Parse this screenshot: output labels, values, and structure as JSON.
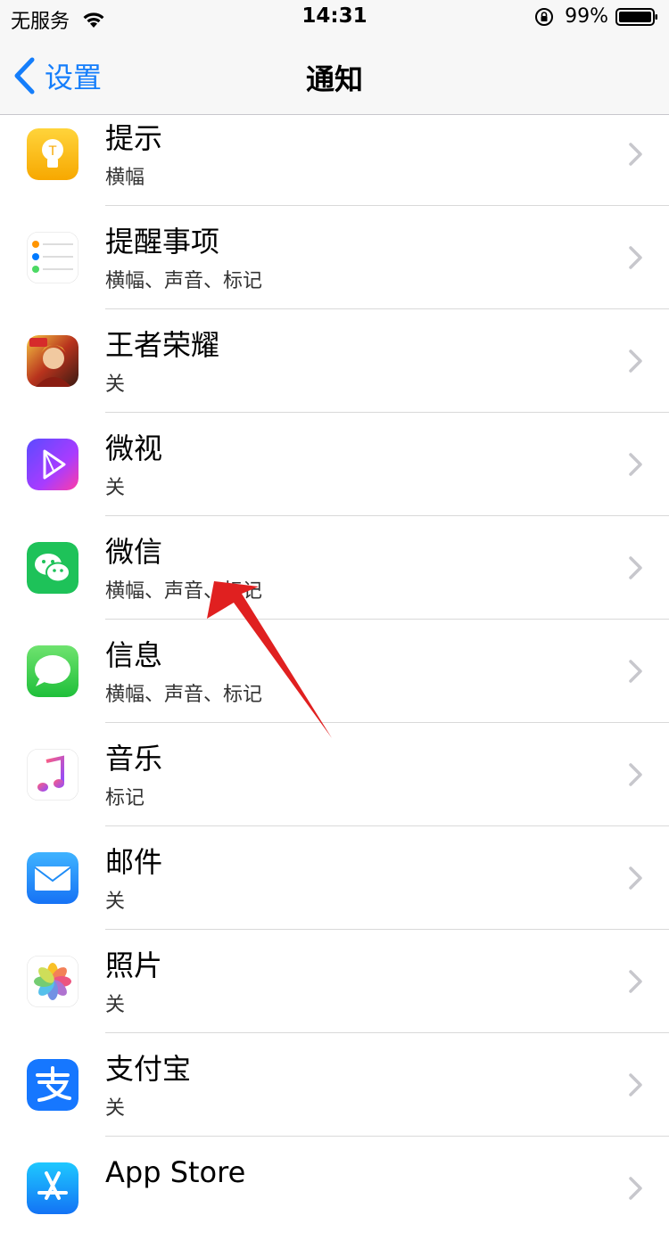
{
  "status": {
    "carrier": "无服务",
    "time": "14:31",
    "battery": "99%"
  },
  "nav": {
    "back_label": "设置",
    "title": "通知"
  },
  "apps": [
    {
      "title": "提示",
      "subtitle": "横幅",
      "icon": "tips-icon"
    },
    {
      "title": "提醒事项",
      "subtitle": "横幅、声音、标记",
      "icon": "reminders-icon"
    },
    {
      "title": "王者荣耀",
      "subtitle": "关",
      "icon": "honor-of-kings-icon"
    },
    {
      "title": "微视",
      "subtitle": "关",
      "icon": "weishi-icon"
    },
    {
      "title": "微信",
      "subtitle": "横幅、声音、标记",
      "icon": "wechat-icon"
    },
    {
      "title": "信息",
      "subtitle": "横幅、声音、标记",
      "icon": "messages-icon"
    },
    {
      "title": "音乐",
      "subtitle": "标记",
      "icon": "music-icon"
    },
    {
      "title": "邮件",
      "subtitle": "关",
      "icon": "mail-icon"
    },
    {
      "title": "照片",
      "subtitle": "关",
      "icon": "photos-icon"
    },
    {
      "title": "支付宝",
      "subtitle": "关",
      "icon": "alipay-icon"
    },
    {
      "title": "App Store",
      "subtitle": "",
      "icon": "app-store-icon"
    }
  ],
  "colors": {
    "accent": "#157efb",
    "annotation_arrow": "#e02020"
  }
}
